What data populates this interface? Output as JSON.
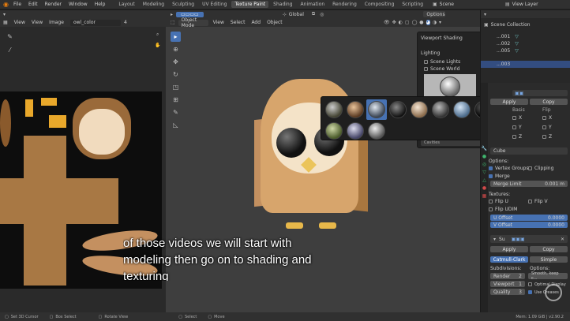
{
  "topbar": {
    "menus": [
      "File",
      "Edit",
      "Render",
      "Window",
      "Help"
    ],
    "workspaces": [
      "Layout",
      "Modeling",
      "Sculpting",
      "UV Editing",
      "Texture Paint",
      "Shading",
      "Animation",
      "Rendering",
      "Compositing",
      "Scripting"
    ],
    "active_workspace": "Texture Paint",
    "scene": "Scene",
    "view_layer": "View Layer"
  },
  "image_editor": {
    "menus": [
      "View",
      "View",
      "Image"
    ],
    "image_name": "owl_color",
    "users": "4"
  },
  "viewport": {
    "mode": "Object Mode",
    "menus": [
      "View",
      "Select",
      "Add",
      "Object"
    ],
    "transform_orientation": "Global",
    "options_label": "Options"
  },
  "shading_popover": {
    "title": "Viewport Shading",
    "lighting_label": "Lighting",
    "scene_lights": "Scene Lights",
    "scene_world": "Scene World",
    "cavity_label": "Cavities"
  },
  "outliner": {
    "title": "Scene Collection",
    "items": [
      "...001",
      "...002",
      "...005"
    ],
    "selected": "...003"
  },
  "properties": {
    "apply": "Apply",
    "copy": "Copy",
    "basis": "Basis",
    "flip": "Flip",
    "axes": [
      "X",
      "Y",
      "Z"
    ],
    "modifier_name": "Cube",
    "options_label": "Options:",
    "vertex_groups": "Vertex Groups",
    "clipping": "Clipping",
    "merge": "Merge",
    "merge_limit_label": "Merge Limit",
    "merge_limit_value": "0.001 m",
    "textures_label": "Textures:",
    "flip_u": "Flip U",
    "flip_v": "Flip V",
    "flip_udim": "Flip UDIM",
    "u_offset_label": "U Offset",
    "u_offset_value": "0.0000",
    "v_offset_label": "V Offset",
    "v_offset_value": "0.0000",
    "subsurf_name": "Su",
    "apply2": "Apply",
    "copy2": "Copy",
    "catmull": "Catmull-Clark",
    "simple": "Simple",
    "subdivisions_label": "Subdivisions:",
    "options2_label": "Options:",
    "render_label": "Render",
    "render_value": "2",
    "viewport_label": "Viewport",
    "viewport_value": "1",
    "quality_label": "Quality",
    "quality_value": "3",
    "smooth_label": "Smooth, keep c...",
    "optimal_display": "Optimal Display",
    "use_crease": "Use Creases"
  },
  "status_bar": {
    "items": [
      "Set 3D Cursor",
      "Box Select",
      "Rotate View",
      "Select",
      "Move"
    ],
    "memory": "Mem: 1.09 GiB | v2.90.2"
  },
  "subtitles": {
    "line1": "of those videos we will start with",
    "line2": "modeling then go on to shading and",
    "line3": "texturing"
  }
}
